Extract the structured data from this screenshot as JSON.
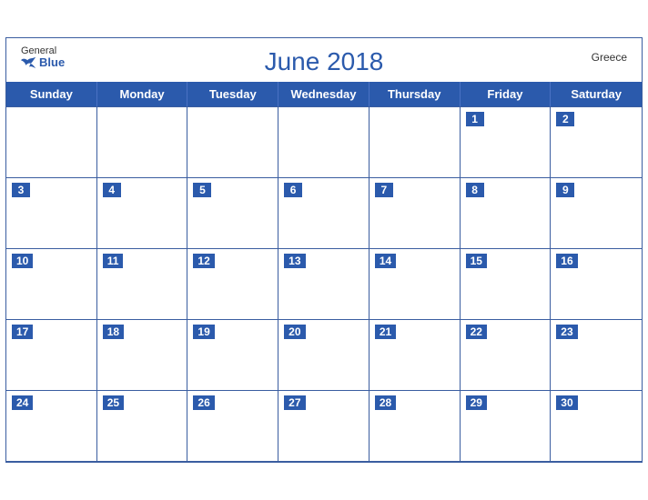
{
  "header": {
    "title": "June 2018",
    "country": "Greece",
    "logo": {
      "general": "General",
      "blue": "Blue"
    }
  },
  "days": [
    "Sunday",
    "Monday",
    "Tuesday",
    "Wednesday",
    "Thursday",
    "Friday",
    "Saturday"
  ],
  "weeks": [
    [
      {
        "day": "",
        "empty": true
      },
      {
        "day": "",
        "empty": true
      },
      {
        "day": "",
        "empty": true
      },
      {
        "day": "",
        "empty": true
      },
      {
        "day": "",
        "empty": true
      },
      {
        "day": "1",
        "empty": false
      },
      {
        "day": "2",
        "empty": false
      }
    ],
    [
      {
        "day": "3",
        "empty": false
      },
      {
        "day": "4",
        "empty": false
      },
      {
        "day": "5",
        "empty": false
      },
      {
        "day": "6",
        "empty": false
      },
      {
        "day": "7",
        "empty": false
      },
      {
        "day": "8",
        "empty": false
      },
      {
        "day": "9",
        "empty": false
      }
    ],
    [
      {
        "day": "10",
        "empty": false
      },
      {
        "day": "11",
        "empty": false
      },
      {
        "day": "12",
        "empty": false
      },
      {
        "day": "13",
        "empty": false
      },
      {
        "day": "14",
        "empty": false
      },
      {
        "day": "15",
        "empty": false
      },
      {
        "day": "16",
        "empty": false
      }
    ],
    [
      {
        "day": "17",
        "empty": false
      },
      {
        "day": "18",
        "empty": false
      },
      {
        "day": "19",
        "empty": false
      },
      {
        "day": "20",
        "empty": false
      },
      {
        "day": "21",
        "empty": false
      },
      {
        "day": "22",
        "empty": false
      },
      {
        "day": "23",
        "empty": false
      }
    ],
    [
      {
        "day": "24",
        "empty": false
      },
      {
        "day": "25",
        "empty": false
      },
      {
        "day": "26",
        "empty": false
      },
      {
        "day": "27",
        "empty": false
      },
      {
        "day": "28",
        "empty": false
      },
      {
        "day": "29",
        "empty": false
      },
      {
        "day": "30",
        "empty": false
      }
    ]
  ]
}
